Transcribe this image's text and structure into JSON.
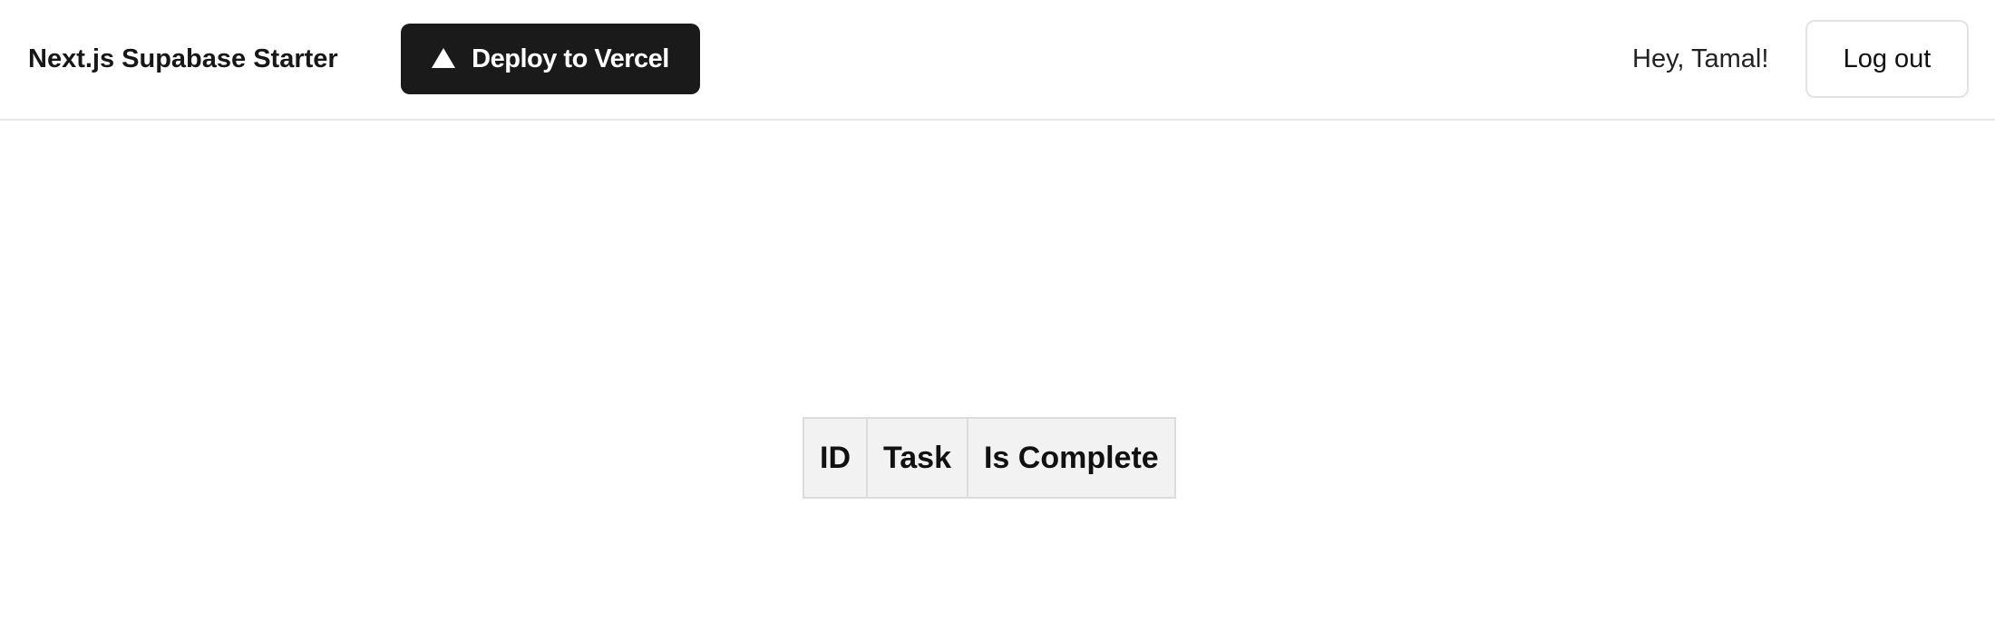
{
  "navbar": {
    "brand": "Next.js Supabase Starter",
    "deploy_button": {
      "label": "Deploy to Vercel",
      "icon": "triangle-icon"
    },
    "greeting": "Hey, Tamal!",
    "logout_label": "Log out"
  },
  "table": {
    "columns": [
      "ID",
      "Task",
      "Is Complete"
    ],
    "rows": []
  },
  "colors": {
    "deploy_button_bg": "#1a1a1a",
    "header_cell_bg": "#f2f2f2",
    "border": "#dcdcdc"
  }
}
